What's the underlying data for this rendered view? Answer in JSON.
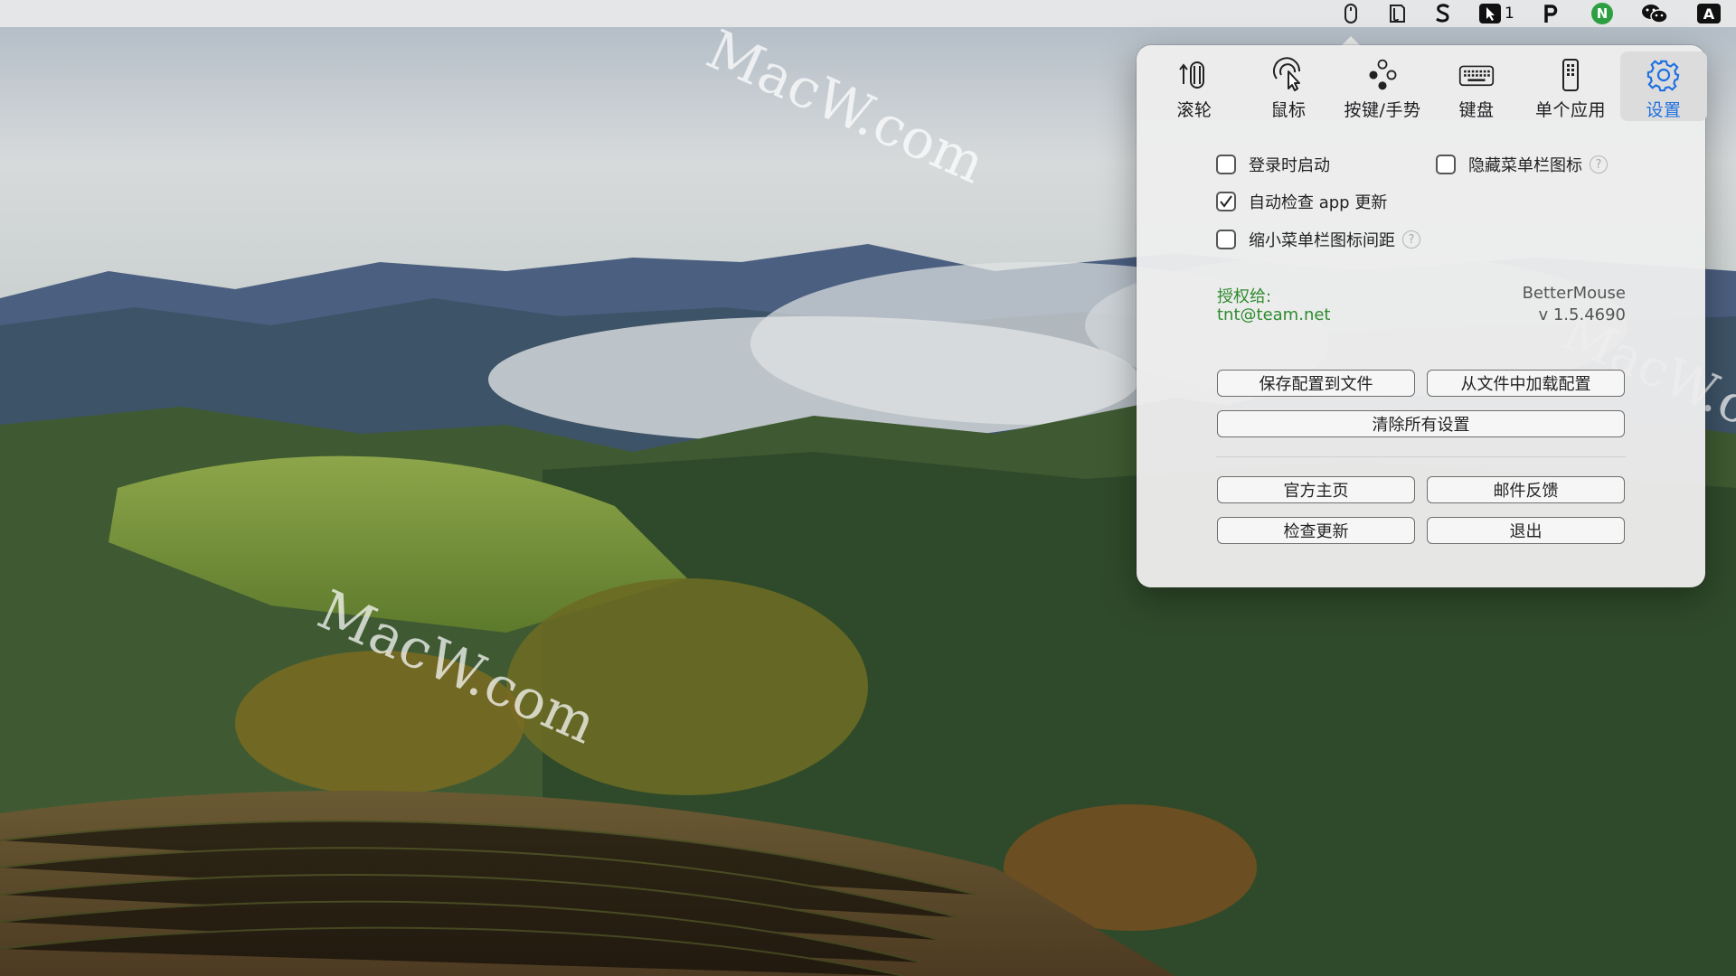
{
  "menubar": {
    "items": [
      {
        "icon": "mouse-icon"
      },
      {
        "icon": "document-icon"
      },
      {
        "icon": "s-logo-icon"
      },
      {
        "icon": "cursor-icon",
        "badge": "1"
      },
      {
        "icon": "p-logo-icon"
      },
      {
        "icon": "n-logo-icon",
        "letter": "N",
        "color": "#2ea043"
      },
      {
        "icon": "wechat-icon"
      },
      {
        "icon": "input-source-icon",
        "letter": "A"
      }
    ]
  },
  "toolbar": {
    "tabs": [
      {
        "label": "滚轮",
        "icon": "scroll-wheel-icon"
      },
      {
        "label": "鼠标",
        "icon": "mouse-pointer-icon"
      },
      {
        "label": "按键/手势",
        "icon": "buttons-gesture-icon"
      },
      {
        "label": "键盘",
        "icon": "keyboard-icon"
      },
      {
        "label": "单个应用",
        "icon": "single-app-icon"
      },
      {
        "label": "设置",
        "icon": "gear-icon",
        "active": true
      }
    ]
  },
  "settings": {
    "launch_at_login": {
      "label": "登录时启动",
      "checked": false
    },
    "hide_menubar_icon": {
      "label": "隐藏菜单栏图标",
      "checked": false
    },
    "auto_check_updates": {
      "label": "自动检查 app 更新",
      "checked": true
    },
    "shrink_icon_spacing": {
      "label": "缩小菜单栏图标间距",
      "checked": false
    },
    "help_glyph": "?"
  },
  "license": {
    "licensed_to_label": "授权给:",
    "email": "tnt@team.net",
    "app_name": "BetterMouse",
    "version": "v 1.5.4690"
  },
  "buttons": {
    "save_config": "保存配置到文件",
    "load_config": "从文件中加载配置",
    "clear_all": "清除所有设置",
    "homepage": "官方主页",
    "feedback": "邮件反馈",
    "check_update": "检查更新",
    "quit": "退出"
  },
  "watermark": "MacW.com",
  "colors": {
    "accent": "#1d6fe0",
    "license_green": "#2e8b2e"
  }
}
